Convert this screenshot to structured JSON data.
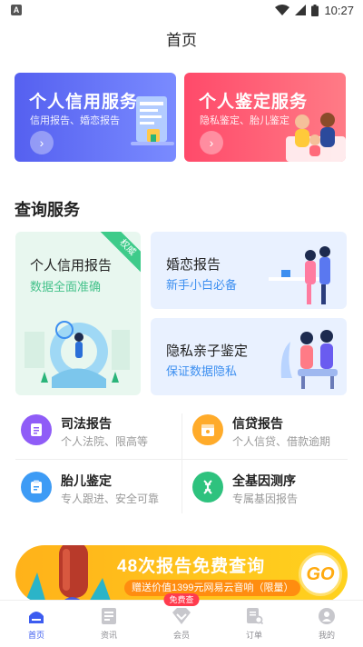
{
  "status_bar": {
    "time": "10:27",
    "app_letter": "A"
  },
  "header": {
    "title": "首页"
  },
  "top_cards": [
    {
      "title": "个人信用服务",
      "subtitle": "信用报告、婚恋报告"
    },
    {
      "title": "个人鉴定服务",
      "subtitle": "隐私鉴定、胎儿鉴定"
    }
  ],
  "section": {
    "title": "查询服务"
  },
  "services": {
    "credit": {
      "title": "个人信用报告",
      "subtitle": "数据全面准确",
      "badge": "权威"
    },
    "marriage": {
      "title": "婚恋报告",
      "subtitle": "新手小白必备"
    },
    "privacy": {
      "title": "隐私亲子鉴定",
      "subtitle": "保证数据隐私"
    }
  },
  "grid": [
    {
      "title": "司法报告",
      "subtitle": "个人法院、限高等"
    },
    {
      "title": "信贷报告",
      "subtitle": "个人信贷、借款逾期"
    },
    {
      "title": "胎儿鉴定",
      "subtitle": "专人跟进、安全可靠"
    },
    {
      "title": "全基因测序",
      "subtitle": "专属基因报告"
    }
  ],
  "banner": {
    "title": "48次报告免费查询",
    "subtitle": "赠送价值1399元网易云音响（限量）",
    "go_label": "GO"
  },
  "tabbar": {
    "items": [
      {
        "label": "首页"
      },
      {
        "label": "资讯"
      },
      {
        "label": "会员"
      },
      {
        "label": "订单"
      },
      {
        "label": "我的"
      }
    ],
    "vip_badge": "免费查",
    "active_color": "#3d5cf0"
  }
}
